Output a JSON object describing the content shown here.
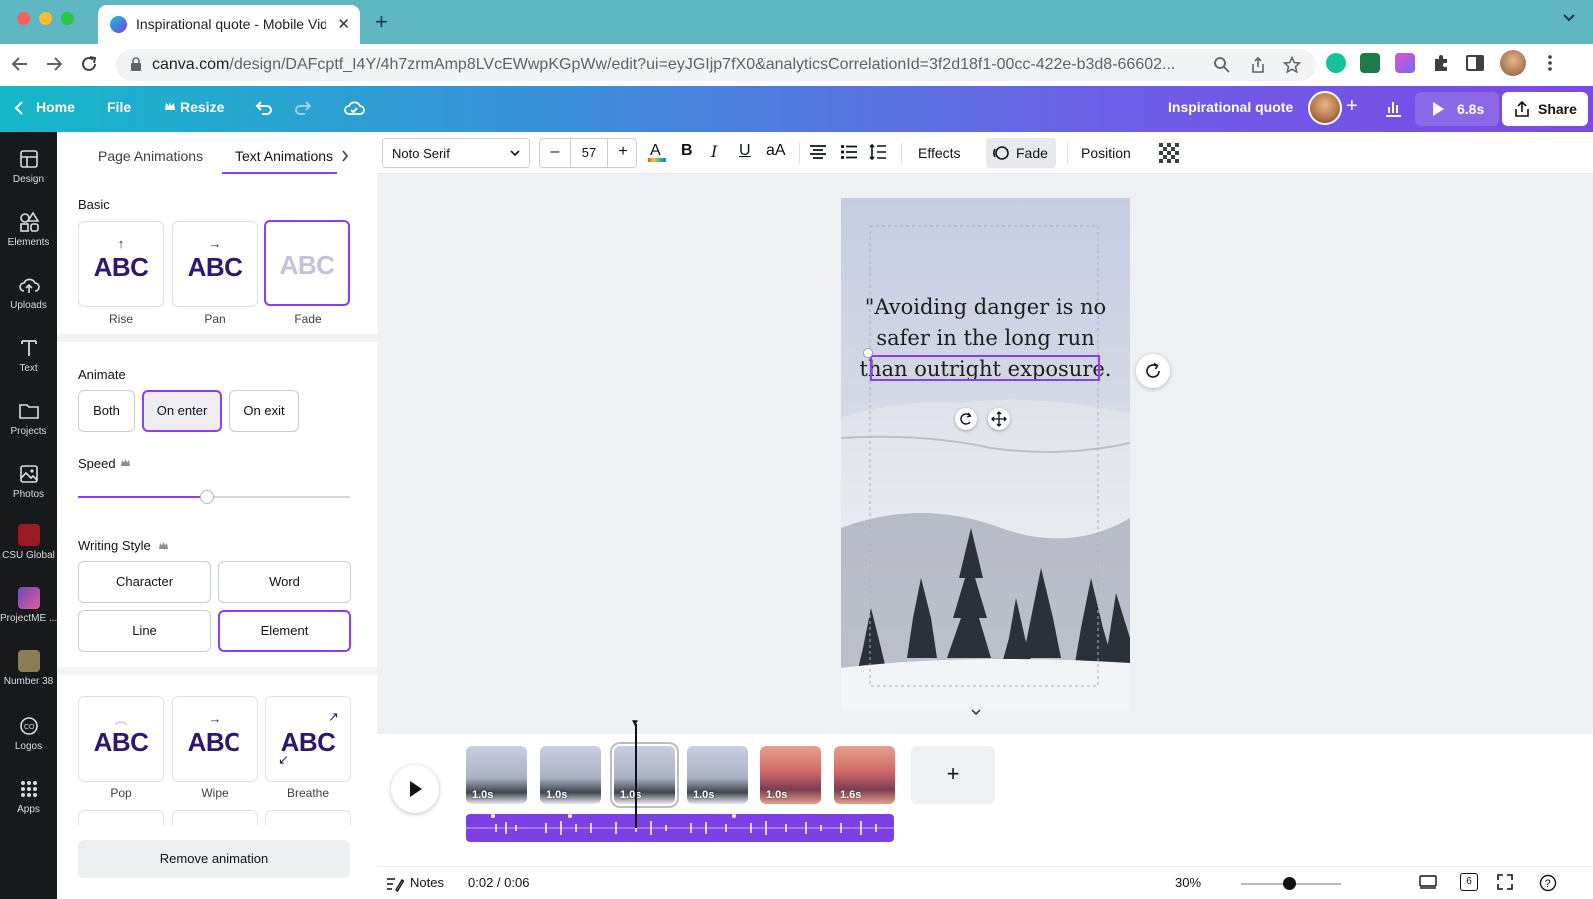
{
  "browser": {
    "tab_title": "Inspirational quote - Mobile Video",
    "url_domain": "canva.com",
    "url_path": "/design/DAFcptf_I4Y/4h7zrmAmp8LVcEWwpKGpWw/edit?ui=eyJGIjp7fX0&analyticsCorrelationId=3f2d18f1-00cc-422e-b3d8-66602..."
  },
  "header": {
    "home": "Home",
    "file": "File",
    "resize": "Resize",
    "doc_title": "Inspirational quote",
    "play_duration": "6.8s",
    "share": "Share"
  },
  "rail": {
    "items": [
      {
        "label": "Design",
        "icon": "design-icon"
      },
      {
        "label": "Elements",
        "icon": "elements-icon"
      },
      {
        "label": "Uploads",
        "icon": "upload-cloud-icon"
      },
      {
        "label": "Text",
        "icon": "text-icon"
      },
      {
        "label": "Projects",
        "icon": "folder-icon"
      },
      {
        "label": "Photos",
        "icon": "photo-icon"
      },
      {
        "label": "CSU Global",
        "icon": "csu-global-thumb"
      },
      {
        "label": "ProjectME ...",
        "icon": "projectme-thumb"
      },
      {
        "label": "Number 38",
        "icon": "number38-thumb"
      },
      {
        "label": "Logos",
        "icon": "logos-icon"
      },
      {
        "label": "Apps",
        "icon": "apps-grid-icon"
      }
    ]
  },
  "panel": {
    "tabs": [
      "Page Animations",
      "Text Animations"
    ],
    "basic_title": "Basic",
    "basic_cards": [
      {
        "label": "Rise",
        "text": "ABC"
      },
      {
        "label": "Pan",
        "text": "ABC"
      },
      {
        "label": "Fade",
        "text": "ABC"
      }
    ],
    "animate_title": "Animate",
    "animate_options": [
      "Both",
      "On enter",
      "On exit"
    ],
    "speed_title": "Speed",
    "speed_value": 0.47,
    "writing_style_title": "Writing Style",
    "writing_styles": [
      "Character",
      "Word",
      "Line",
      "Element"
    ],
    "more_cards": [
      {
        "label": "Pop",
        "text": "ABC"
      },
      {
        "label": "Wipe",
        "text": "ABC"
      },
      {
        "label": "Breathe",
        "text": "ABC"
      }
    ],
    "remove": "Remove animation"
  },
  "toolbar": {
    "font": "Noto Serif",
    "size": "57",
    "minus": "–",
    "plus": "+",
    "effects": "Effects",
    "fade": "Fade",
    "position": "Position"
  },
  "canvas": {
    "quote_line1": "\"Avoiding danger is no",
    "quote_line2": "safer in the long run",
    "quote_line3": "than outright exposure."
  },
  "timeline": {
    "clips": [
      {
        "duration": "1.0s"
      },
      {
        "duration": "1.0s"
      },
      {
        "duration": "1.0s"
      },
      {
        "duration": "1.0s"
      },
      {
        "duration": "1.0s"
      },
      {
        "duration": "1.6s"
      }
    ],
    "add": "+"
  },
  "footer": {
    "notes": "Notes",
    "time": "0:02 / 0:06",
    "zoom": "30%",
    "pages": "6"
  },
  "colors": {
    "accent": "#8b3dff",
    "rail_bg": "#18191b",
    "audio_track": "#7b3fe4"
  }
}
